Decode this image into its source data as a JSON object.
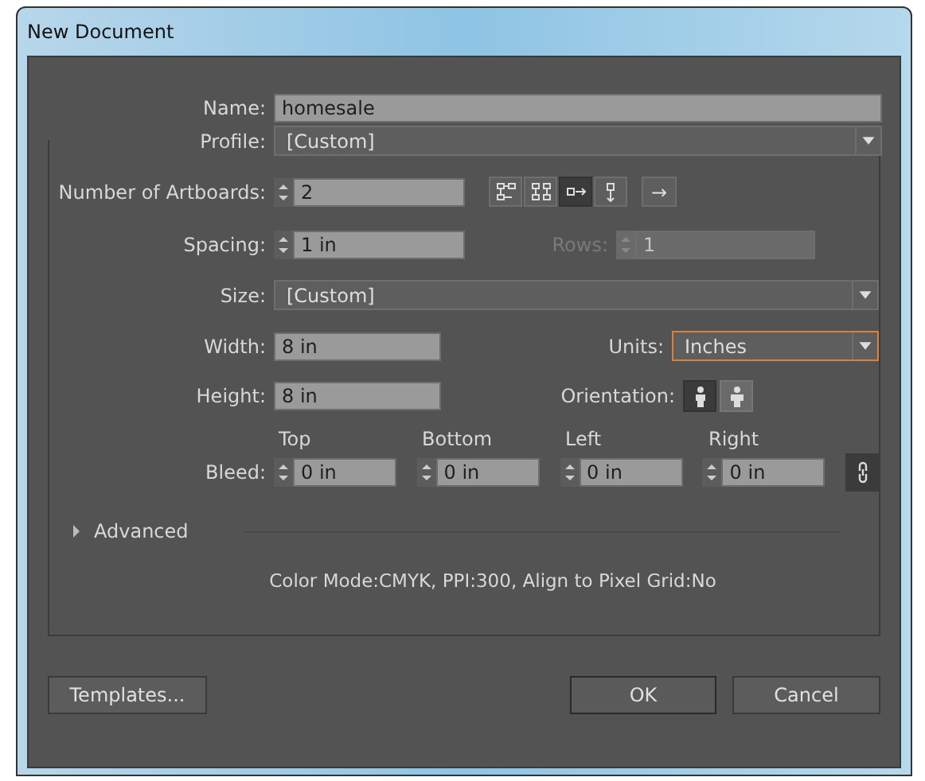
{
  "window": {
    "title": "New Document"
  },
  "name": {
    "label": "Name:",
    "value": "homesale"
  },
  "profile": {
    "label": "Profile:",
    "value": "[Custom]"
  },
  "artboards": {
    "label": "Number of Artboards:",
    "value": "2",
    "arrangements": [
      {
        "selected": false
      },
      {
        "selected": false
      },
      {
        "selected": true
      },
      {
        "selected": false
      }
    ],
    "direction_button": "→"
  },
  "spacing": {
    "label": "Spacing:",
    "value": "1 in"
  },
  "rows": {
    "label": "Rows:",
    "value": "1",
    "disabled": true
  },
  "size": {
    "label": "Size:",
    "value": "[Custom]"
  },
  "width": {
    "label": "Width:",
    "value": "8 in"
  },
  "units": {
    "label": "Units:",
    "value": "Inches",
    "focused": true
  },
  "height": {
    "label": "Height:",
    "value": "8 in"
  },
  "orientation": {
    "label": "Orientation:",
    "options": [
      {
        "selected": true
      },
      {
        "selected": false
      }
    ]
  },
  "bleed": {
    "label": "Bleed:",
    "fields": [
      {
        "label": "Top",
        "value": "0 in"
      },
      {
        "label": "Bottom",
        "value": "0 in"
      },
      {
        "label": "Left",
        "value": "0 in"
      },
      {
        "label": "Right",
        "value": "0 in"
      }
    ]
  },
  "advanced": {
    "label": "Advanced",
    "expanded": false
  },
  "info": "Color Mode:CMYK, PPI:300, Align to Pixel Grid:No",
  "buttons": [
    {
      "label": "Templates...",
      "kind": "secondary"
    },
    {
      "label": "OK",
      "kind": "default"
    },
    {
      "label": "Cancel",
      "kind": "secondary"
    }
  ]
}
